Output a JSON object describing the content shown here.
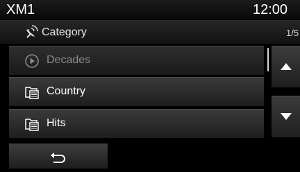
{
  "header": {
    "title": "XM1",
    "clock": "12:00"
  },
  "subheader": {
    "icon": "satellite-icon",
    "label": "Category",
    "page": "1/5"
  },
  "list": {
    "items": [
      {
        "label": "Decades",
        "icon": "play-circle-icon",
        "state": "disabled"
      },
      {
        "label": "Country",
        "icon": "folder-list-icon",
        "state": "enabled"
      },
      {
        "label": "Hits",
        "icon": "folder-list-icon",
        "state": "enabled"
      }
    ]
  },
  "scroll": {
    "up_icon": "triangle-up-icon",
    "down_icon": "triangle-down-icon"
  },
  "footer": {
    "back_icon": "return-arrow-icon"
  }
}
